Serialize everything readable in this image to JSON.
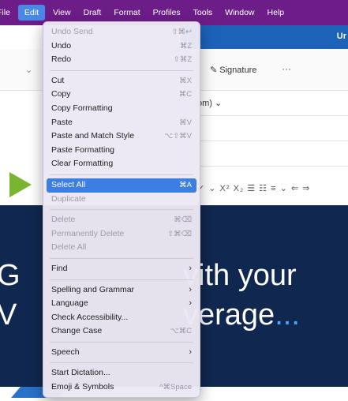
{
  "menubar": {
    "items": [
      {
        "label": "File"
      },
      {
        "label": "Edit"
      },
      {
        "label": "View"
      },
      {
        "label": "Draft"
      },
      {
        "label": "Format"
      },
      {
        "label": "Profiles"
      },
      {
        "label": "Tools"
      },
      {
        "label": "Window"
      },
      {
        "label": "Help"
      }
    ],
    "active_item": "Edit"
  },
  "edit_menu": {
    "undo_send": {
      "label": "Undo Send",
      "shortcut": "⇧⌘↩"
    },
    "undo": {
      "label": "Undo",
      "shortcut": "⌘Z"
    },
    "redo": {
      "label": "Redo",
      "shortcut": "⇧⌘Z"
    },
    "cut": {
      "label": "Cut",
      "shortcut": "⌘X"
    },
    "copy": {
      "label": "Copy",
      "shortcut": "⌘C"
    },
    "copy_formatting": {
      "label": "Copy Formatting"
    },
    "paste": {
      "label": "Paste",
      "shortcut": "⌘V"
    },
    "paste_match": {
      "label": "Paste and Match Style",
      "shortcut": "⌥⇧⌘V"
    },
    "paste_formatting": {
      "label": "Paste Formatting"
    },
    "clear_formatting": {
      "label": "Clear Formatting"
    },
    "select_all": {
      "label": "Select All",
      "shortcut": "⌘A"
    },
    "duplicate": {
      "label": "Duplicate"
    },
    "delete": {
      "label": "Delete",
      "shortcut": "⌘⌫"
    },
    "permanently_delete": {
      "label": "Permanently Delete",
      "shortcut": "⇧⌘⌫"
    },
    "delete_all": {
      "label": "Delete All"
    },
    "find": {
      "label": "Find"
    },
    "spelling": {
      "label": "Spelling and Grammar"
    },
    "language": {
      "label": "Language"
    },
    "check_accessibility": {
      "label": "Check Accessibility..."
    },
    "change_case": {
      "label": "Change Case",
      "shortcut": "⌥⌘C"
    },
    "speech": {
      "label": "Speech"
    },
    "start_dictation": {
      "label": "Start Dictation..."
    },
    "emoji": {
      "label": "Emoji & Symbols",
      "shortcut": "^⌘Space"
    },
    "submenu_glyph": "›"
  },
  "window": {
    "header_text": "Ur",
    "signature_label": "Signature",
    "more_label": "···",
    "from_fragment": "om) ⌄",
    "format_bar": "✓ ⌄ X² X₂  ☰ ☷ ≡ ⌄ ⇐ ⇒",
    "banner_line1_left": "G",
    "banner_line1_right": "vith your",
    "banner_line2_left": "V",
    "banner_line2_right": "verage",
    "banner_dots": "..."
  },
  "colors": {
    "menubar_bg": "#6c1d88",
    "menu_highlight": "#3d7ee3",
    "arrow": "#7ab531",
    "banner_bg": "#10274f",
    "header_blue": "#1c62b9"
  }
}
